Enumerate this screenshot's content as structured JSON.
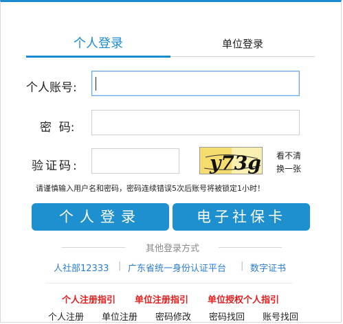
{
  "tabs": {
    "personal": "个人登录",
    "unit": "单位登录"
  },
  "form": {
    "account_label": "个人账号:",
    "password_label": "密  码:",
    "captcha_label": "验证码:",
    "captcha_text": "y73g",
    "refresh_line1": "看不清",
    "refresh_line2": "换一张"
  },
  "notice": "请谨慎输入用户名和密码，密码连续错误5次后账号将被锁定1小时！",
  "buttons": {
    "personal_login": "个人登录",
    "social_card": "电子社保卡"
  },
  "other_login": {
    "title": "其他登录方式",
    "links": [
      "人社部12333",
      "广东省统一身份认证平台",
      "数字证书"
    ]
  },
  "guides": [
    "个人注册指引",
    "单位注册指引",
    "单位授权个人指引"
  ],
  "bottom_links": [
    "个人注册",
    "单位注册",
    "密码修改",
    "密码找回",
    "账号找回"
  ],
  "colors": {
    "primary": "#1e90cf",
    "red": "#e21e1e",
    "link": "#2a7ed3"
  }
}
